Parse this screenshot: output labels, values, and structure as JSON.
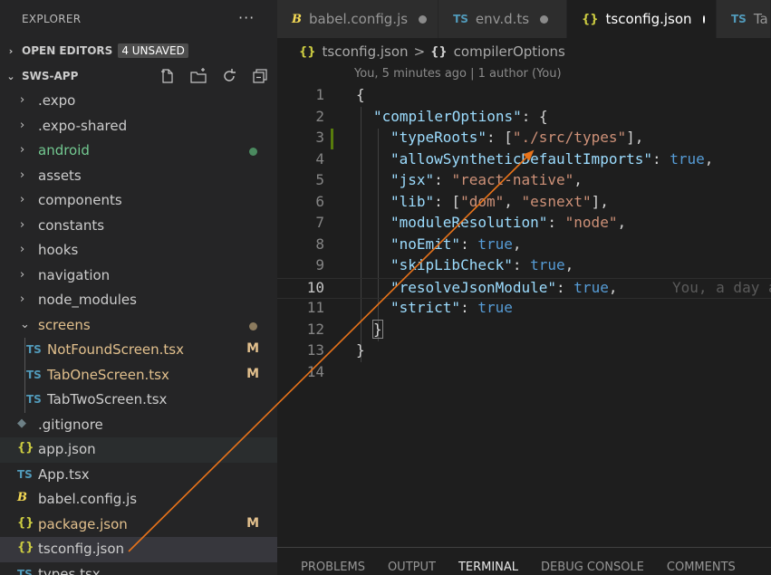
{
  "explorer": {
    "title": "EXPLORER",
    "more": "···",
    "open_editors": {
      "label": "OPEN EDITORS",
      "badge": "4 UNSAVED"
    },
    "workspace": {
      "label": "SWS-APP"
    },
    "tree": [
      {
        "label": ".expo",
        "type": "folder"
      },
      {
        "label": ".expo-shared",
        "type": "folder"
      },
      {
        "label": "android",
        "type": "folder"
      },
      {
        "label": "assets",
        "type": "folder"
      },
      {
        "label": "components",
        "type": "folder"
      },
      {
        "label": "constants",
        "type": "folder"
      },
      {
        "label": "hooks",
        "type": "folder"
      },
      {
        "label": "navigation",
        "type": "folder"
      },
      {
        "label": "node_modules",
        "type": "folder"
      },
      {
        "label": "screens",
        "type": "folder-open"
      },
      {
        "label": "NotFoundScreen.tsx",
        "icon": "TS",
        "deco": "M"
      },
      {
        "label": "TabOneScreen.tsx",
        "icon": "TS",
        "deco": "M"
      },
      {
        "label": "TabTwoScreen.tsx",
        "icon": "TS"
      },
      {
        "label": ".gitignore",
        "icon": "◆"
      },
      {
        "label": "app.json",
        "icon": "{}"
      },
      {
        "label": "App.tsx",
        "icon": "TS"
      },
      {
        "label": "babel.config.js",
        "icon": "B"
      },
      {
        "label": "package.json",
        "icon": "{}",
        "deco": "M"
      },
      {
        "label": "tsconfig.json",
        "icon": "{}"
      },
      {
        "label": "types.tsx",
        "icon": "TS"
      }
    ]
  },
  "tabs": [
    {
      "label": "babel.config.js",
      "icon": "B"
    },
    {
      "label": "env.d.ts",
      "icon": "TS"
    },
    {
      "label": "tsconfig.json",
      "icon": "{}"
    },
    {
      "label": "Ta",
      "icon": "TS"
    }
  ],
  "breadcrumb": {
    "file": "tsconfig.json",
    "sep": ">",
    "symbol": "compilerOptions",
    "file_icon": "{}",
    "symbol_icon": "{}"
  },
  "editor": {
    "blame": "You, 5 minutes ago | 1 author (You)",
    "inline_blame": "You, a day a",
    "line_numbers": [
      "1",
      "2",
      "3",
      "4",
      "5",
      "6",
      "7",
      "8",
      "9",
      "10",
      "11",
      "12",
      "13",
      "14"
    ],
    "lines": {
      "l1": "{",
      "l2_key": "\"compilerOptions\"",
      "l2_rest": ": {",
      "l3_key": "\"typeRoots\"",
      "l3_a": ": [",
      "l3_str": "\"./src/types\"",
      "l3_b": "],",
      "l4_key": "\"allowSyntheticDefaultImports\"",
      "l4_a": ": ",
      "l4_val": "true",
      "l4_b": ",",
      "l5_key": "\"jsx\"",
      "l5_a": ": ",
      "l5_str": "\"react-native\"",
      "l5_b": ",",
      "l6_key": "\"lib\"",
      "l6_a": ": [",
      "l6_s1": "\"dom\"",
      "l6_c": ", ",
      "l6_s2": "\"esnext\"",
      "l6_b": "],",
      "l7_key": "\"moduleResolution\"",
      "l7_a": ": ",
      "l7_str": "\"node\"",
      "l7_b": ",",
      "l8_key": "\"noEmit\"",
      "l8_a": ": ",
      "l8_val": "true",
      "l8_b": ",",
      "l9_key": "\"skipLibCheck\"",
      "l9_a": ": ",
      "l9_val": "true",
      "l9_b": ",",
      "l10_key": "\"resolveJsonModule\"",
      "l10_a": ": ",
      "l10_val": "true",
      "l10_b": ",",
      "l11_key": "\"strict\"",
      "l11_a": ": ",
      "l11_val": "true",
      "l12": "}",
      "l13": "}"
    }
  },
  "panel": {
    "tabs": [
      "PROBLEMS",
      "OUTPUT",
      "TERMINAL",
      "DEBUG CONSOLE",
      "COMMENTS"
    ],
    "active": "TERMINAL"
  },
  "colors": {
    "accent_arrow": "#e8731a",
    "modified": "#e2c08d",
    "untracked": "#73c991"
  }
}
